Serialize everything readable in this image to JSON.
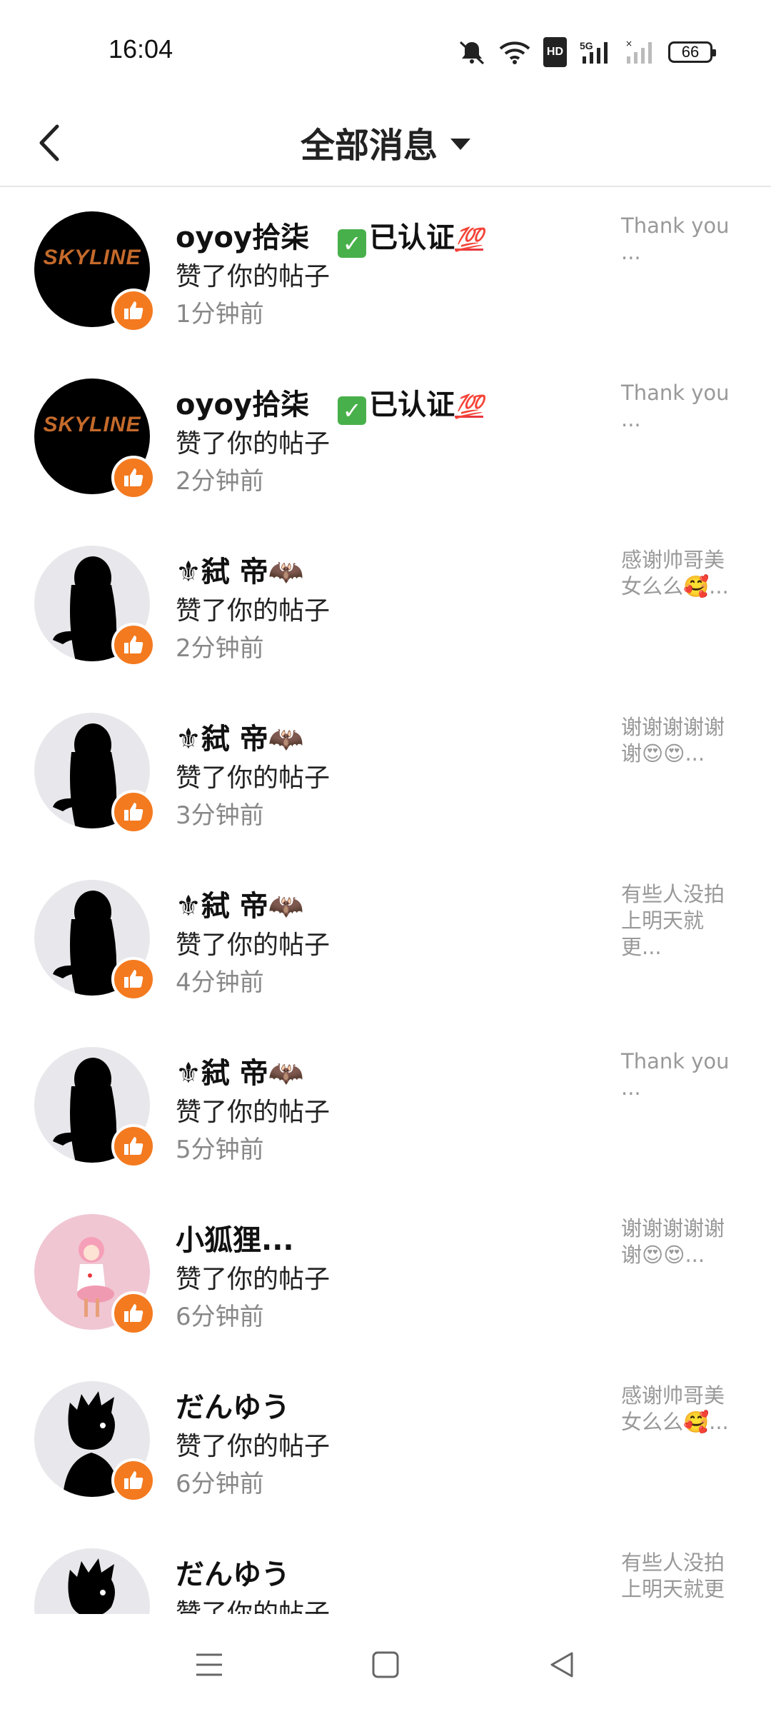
{
  "status_bar": {
    "time": "16:04",
    "network": "5G",
    "hd_label": "HD",
    "battery": "66",
    "icons": [
      "mute-icon",
      "wifi-icon",
      "hd-icon",
      "signal-5g-icon",
      "signal-2-icon",
      "battery-icon"
    ]
  },
  "header": {
    "back_icon": "chevron-left-icon",
    "title": "全部消息",
    "dropdown_icon": "caret-down-icon"
  },
  "accent_color": "#f47a1f",
  "messages": [
    {
      "name": "oyoy拾柒",
      "verified_text": "已认证",
      "verified_emoji": "💯",
      "action": "赞了你的帖子",
      "time": "1分钟前",
      "preview": "Thank you ...",
      "avatar": "skyline",
      "avatar_text": "SKYLINE"
    },
    {
      "name": "oyoy拾柒",
      "verified_text": "已认证",
      "verified_emoji": "💯",
      "action": "赞了你的帖子",
      "time": "2分钟前",
      "preview": "Thank you ...",
      "avatar": "skyline",
      "avatar_text": "SKYLINE"
    },
    {
      "name": "⚜弑 帝🦇",
      "action": "赞了你的帖子",
      "time": "2分钟前",
      "preview": "感谢帅哥美女么么🥰...",
      "avatar": "silhouette-girl"
    },
    {
      "name": "⚜弑 帝🦇",
      "action": "赞了你的帖子",
      "time": "3分钟前",
      "preview": "谢谢谢谢谢谢😍😍...",
      "avatar": "silhouette-girl"
    },
    {
      "name": "⚜弑 帝🦇",
      "action": "赞了你的帖子",
      "time": "4分钟前",
      "preview": "有些人没拍上明天就更...",
      "avatar": "silhouette-girl"
    },
    {
      "name": "⚜弑 帝🦇",
      "action": "赞了你的帖子",
      "time": "5分钟前",
      "preview": "Thank you ...",
      "avatar": "silhouette-girl"
    },
    {
      "name": "小狐狸...",
      "action": "赞了你的帖子",
      "time": "6分钟前",
      "preview": "谢谢谢谢谢谢😍😍...",
      "avatar": "pink-doll"
    },
    {
      "name": "だんゆう",
      "action": "赞了你的帖子",
      "time": "6分钟前",
      "preview": "感谢帅哥美女么么🥰...",
      "avatar": "silhouette-boy"
    },
    {
      "name": "だんゆう",
      "action": "赞了你的帖子",
      "time": "",
      "preview": "有些人没拍上明天就更",
      "avatar": "silhouette-boy"
    }
  ],
  "nav_bar": {
    "icons": [
      "menu-icon",
      "home-square-icon",
      "back-triangle-icon"
    ]
  }
}
